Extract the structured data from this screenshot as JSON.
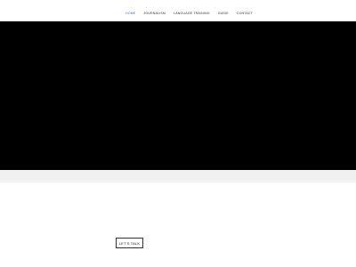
{
  "nav": {
    "items": [
      {
        "label": "HOME",
        "active": true
      },
      {
        "label": "JOURNALISM",
        "active": false
      },
      {
        "label": "LANGUAGE TRAINING",
        "active": false
      },
      {
        "label": "GUIDE",
        "active": false
      },
      {
        "label": "CONTACT",
        "active": false
      }
    ]
  },
  "cta": {
    "label": "LET'S TALK"
  },
  "colors": {
    "active_nav": "#3b6fd6",
    "hero_background": "#000000",
    "band_background": "#f0f0f0"
  }
}
